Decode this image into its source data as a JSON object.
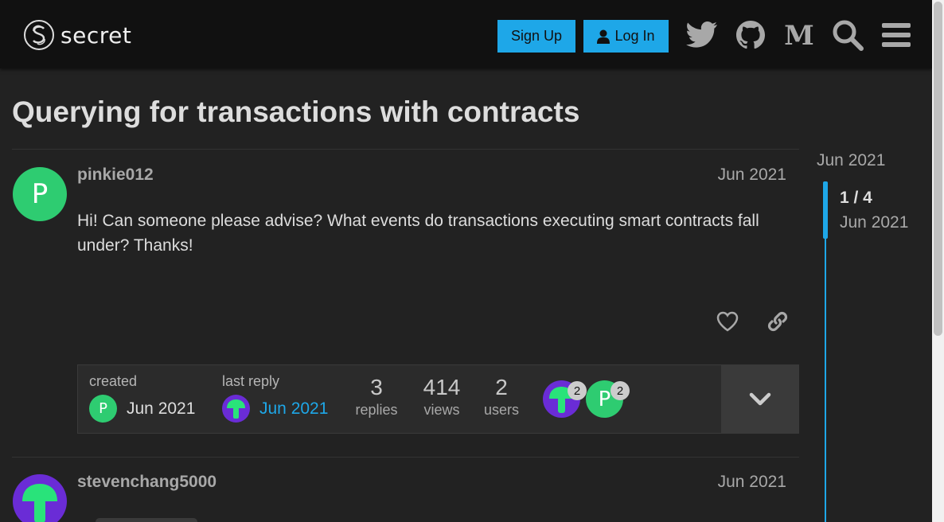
{
  "header": {
    "logo_text": "secret",
    "signup_label": "Sign Up",
    "login_label": "Log In",
    "icons": [
      "twitter-icon",
      "github-icon",
      "medium-icon",
      "search-icon",
      "hamburger-menu-icon"
    ]
  },
  "topic": {
    "title": "Querying for transactions with contracts"
  },
  "posts": [
    {
      "avatar_letter": "P",
      "username": "pinkie012",
      "date": "Jun 2021",
      "body": "Hi! Can someone please advise? What events do transactions executing smart contracts fall under? Thanks!"
    },
    {
      "username": "stevenchang5000",
      "date": "Jun 2021"
    }
  ],
  "topic_map": {
    "created_label": "created",
    "created_date": "Jun 2021",
    "created_avatar_letter": "P",
    "last_reply_label": "last reply",
    "last_reply_date": "Jun 2021",
    "replies_count": "3",
    "replies_label": "replies",
    "views_count": "414",
    "views_label": "views",
    "users_count": "2",
    "users_label": "users",
    "participants": [
      {
        "count": "2"
      },
      {
        "letter": "P",
        "count": "2"
      }
    ]
  },
  "timeline": {
    "top_date": "Jun 2021",
    "position": "1 / 4",
    "position_date": "Jun 2021"
  },
  "colors": {
    "accent": "#1ea7e8",
    "avatar_green": "#2ecc71",
    "avatar_purple": "#6a2cd6",
    "mushroom_green": "#29e37a"
  }
}
